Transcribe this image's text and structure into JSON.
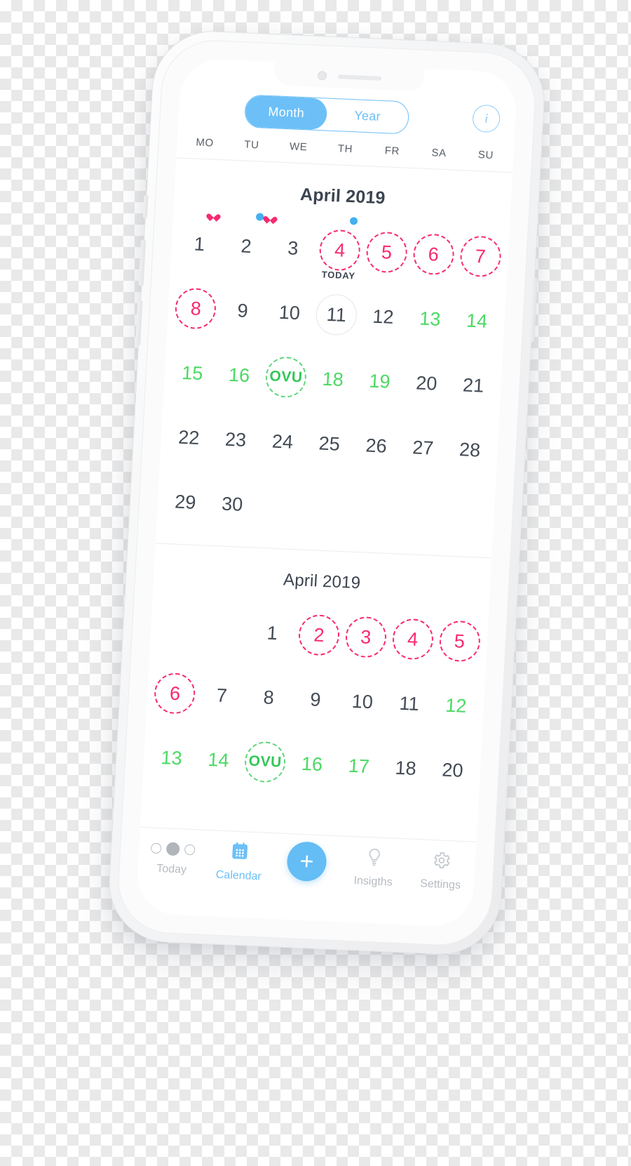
{
  "app": {
    "segmented": {
      "month_label": "Month",
      "year_label": "Year",
      "selected": "Month"
    },
    "info_button": {
      "glyph": "i",
      "name": "info-icon"
    },
    "accent_blue": "#6cc0f7",
    "period_pink": "#f72a72",
    "fertile_green": "#4cd964",
    "ovulation_green": "#34c759"
  },
  "weekdays": [
    "MO",
    "TU",
    "WE",
    "TH",
    "FR",
    "SA",
    "SU"
  ],
  "month_primary": {
    "title": "April 2019",
    "weeks": [
      [
        {
          "label": "1",
          "state": "normal",
          "marks": [
            "heart"
          ]
        },
        {
          "label": "2",
          "state": "normal",
          "marks": [
            "dot",
            "heart"
          ]
        },
        {
          "label": "3",
          "state": "normal",
          "marks": []
        },
        {
          "label": "4",
          "state": "period",
          "marks": [
            "dot"
          ]
        },
        {
          "label": "5",
          "state": "period",
          "marks": []
        },
        {
          "label": "6",
          "state": "period",
          "marks": []
        },
        {
          "label": "7",
          "state": "period",
          "marks": []
        }
      ],
      [
        {
          "label": "8",
          "state": "period",
          "marks": []
        },
        {
          "label": "9",
          "state": "normal",
          "marks": []
        },
        {
          "label": "10",
          "state": "normal",
          "marks": []
        },
        {
          "label": "11",
          "state": "today",
          "marks": [],
          "today_label": "TODAY"
        },
        {
          "label": "12",
          "state": "normal",
          "marks": []
        },
        {
          "label": "13",
          "state": "fertile",
          "marks": []
        },
        {
          "label": "14",
          "state": "fertile",
          "marks": []
        }
      ],
      [
        {
          "label": "15",
          "state": "fertile",
          "marks": []
        },
        {
          "label": "16",
          "state": "fertile",
          "marks": []
        },
        {
          "label": "OVU",
          "state": "ovulation",
          "marks": []
        },
        {
          "label": "18",
          "state": "fertile",
          "marks": []
        },
        {
          "label": "19",
          "state": "fertile",
          "marks": []
        },
        {
          "label": "20",
          "state": "normal",
          "marks": []
        },
        {
          "label": "21",
          "state": "normal",
          "marks": []
        }
      ],
      [
        {
          "label": "22",
          "state": "normal",
          "marks": []
        },
        {
          "label": "23",
          "state": "normal",
          "marks": []
        },
        {
          "label": "24",
          "state": "normal",
          "marks": []
        },
        {
          "label": "25",
          "state": "normal",
          "marks": []
        },
        {
          "label": "26",
          "state": "normal",
          "marks": []
        },
        {
          "label": "27",
          "state": "normal",
          "marks": []
        },
        {
          "label": "28",
          "state": "normal",
          "marks": []
        }
      ],
      [
        {
          "label": "29",
          "state": "normal",
          "marks": []
        },
        {
          "label": "30",
          "state": "normal",
          "marks": []
        },
        {
          "label": "",
          "state": "empty",
          "marks": []
        },
        {
          "label": "",
          "state": "empty",
          "marks": []
        },
        {
          "label": "",
          "state": "empty",
          "marks": []
        },
        {
          "label": "",
          "state": "empty",
          "marks": []
        },
        {
          "label": "",
          "state": "empty",
          "marks": []
        }
      ]
    ]
  },
  "month_secondary": {
    "title": "April 2019",
    "weeks": [
      [
        {
          "label": "",
          "state": "empty",
          "marks": []
        },
        {
          "label": "",
          "state": "empty",
          "marks": []
        },
        {
          "label": "1",
          "state": "normal",
          "marks": []
        },
        {
          "label": "2",
          "state": "period",
          "marks": []
        },
        {
          "label": "3",
          "state": "period",
          "marks": []
        },
        {
          "label": "4",
          "state": "period",
          "marks": []
        },
        {
          "label": "5",
          "state": "period",
          "marks": []
        }
      ],
      [
        {
          "label": "6",
          "state": "period",
          "marks": []
        },
        {
          "label": "7",
          "state": "normal",
          "marks": []
        },
        {
          "label": "8",
          "state": "normal",
          "marks": []
        },
        {
          "label": "9",
          "state": "normal",
          "marks": []
        },
        {
          "label": "10",
          "state": "normal",
          "marks": []
        },
        {
          "label": "11",
          "state": "normal",
          "marks": []
        },
        {
          "label": "12",
          "state": "fertile",
          "marks": []
        }
      ],
      [
        {
          "label": "13",
          "state": "fertile",
          "marks": []
        },
        {
          "label": "14",
          "state": "fertile",
          "marks": []
        },
        {
          "label": "OVU",
          "state": "ovulation",
          "marks": []
        },
        {
          "label": "16",
          "state": "fertile",
          "marks": []
        },
        {
          "label": "17",
          "state": "fertile",
          "marks": []
        },
        {
          "label": "18",
          "state": "normal",
          "marks": []
        },
        {
          "label": "20",
          "state": "normal",
          "marks": []
        }
      ]
    ]
  },
  "tabbar": {
    "items": [
      {
        "label": "Today",
        "icon": "today-dots-icon",
        "active": false
      },
      {
        "label": "Calendar",
        "icon": "calendar-icon",
        "active": true
      },
      {
        "label": "",
        "icon": "add-icon",
        "active": false
      },
      {
        "label": "Insigths",
        "icon": "lightbulb-icon",
        "active": false
      },
      {
        "label": "Settings",
        "icon": "gear-icon",
        "active": false
      }
    ]
  }
}
